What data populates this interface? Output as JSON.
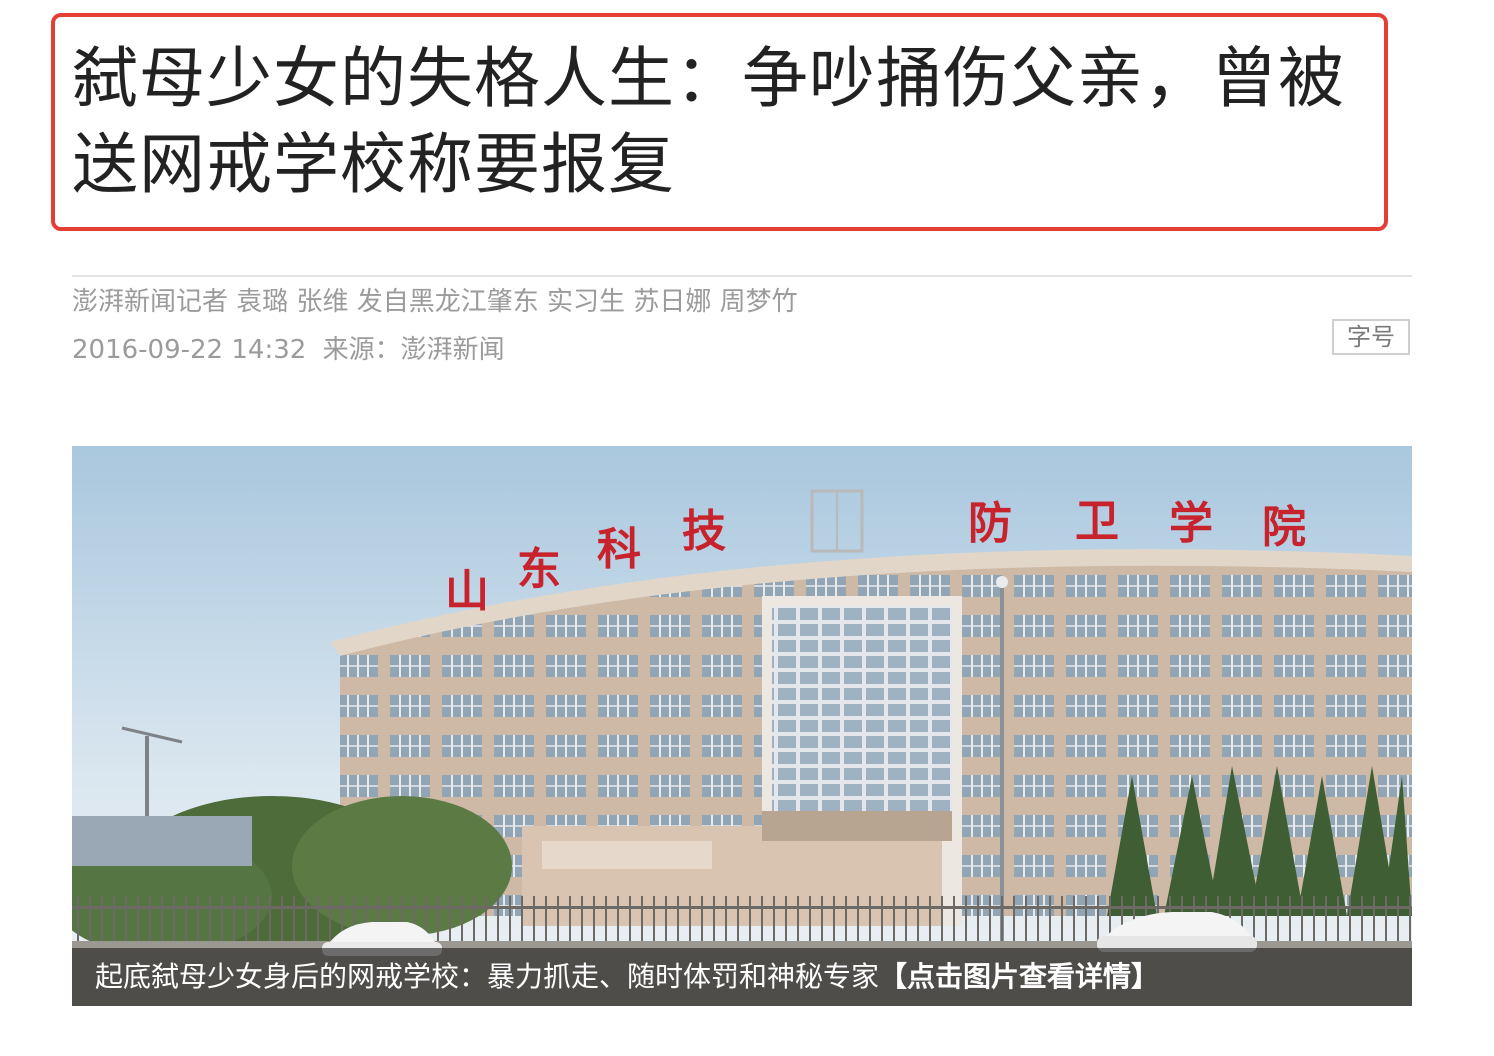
{
  "article": {
    "headline": "弑母少女的失格人生：争吵捅伤父亲，曾被送网戒学校称要报复",
    "byline": "澎湃新闻记者 袁璐 张维 发自黑龙江肇东 实习生 苏日娜 周梦竹",
    "datetime": "2016-09-22 14:32",
    "source_label": "来源：澎湃新闻",
    "font_size_button": "字号"
  },
  "photo": {
    "sign_left": [
      "山",
      "东",
      "科",
      "技"
    ],
    "sign_right": [
      "防",
      "卫",
      "学",
      "院"
    ],
    "caption": "起底弑母少女身后的网戒学校：暴力抓走、随时体罚和神秘专家",
    "caption_link": "【点击图片查看详情】"
  },
  "colors": {
    "annotation_box": "#e53f33",
    "headline_text": "#222222",
    "meta_text": "#9b9b9b",
    "sign_red": "#c8232c"
  }
}
